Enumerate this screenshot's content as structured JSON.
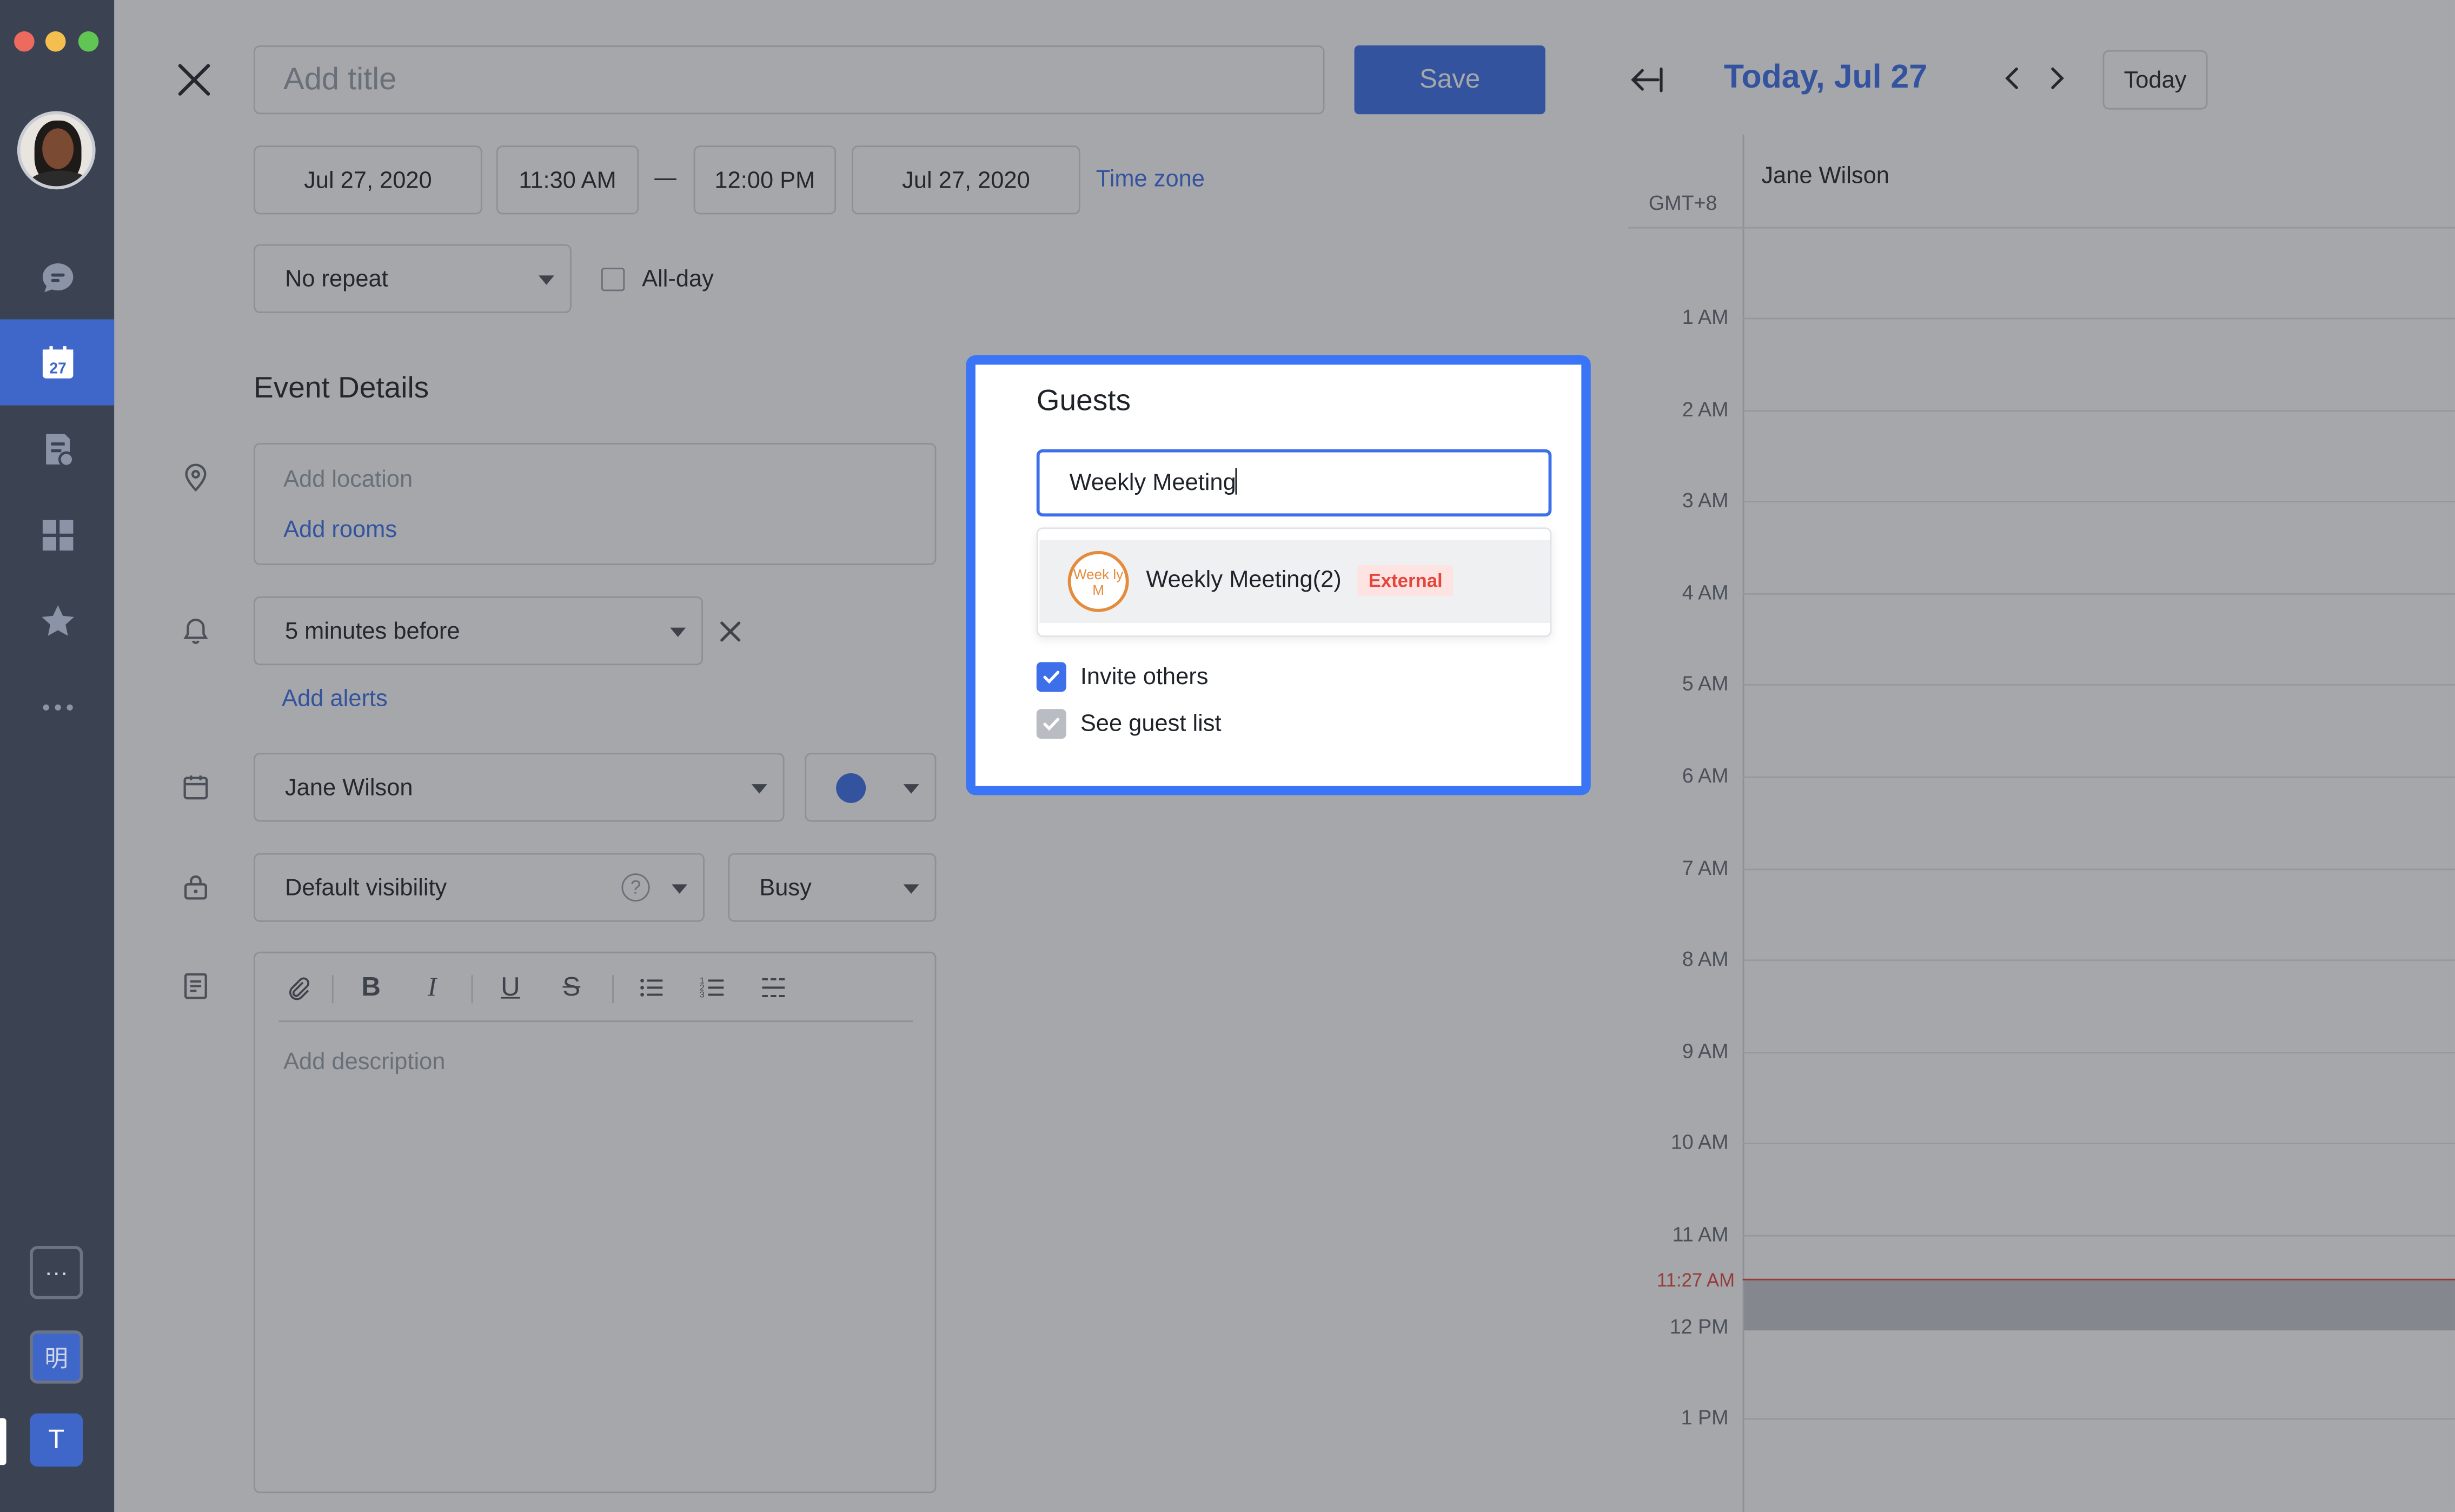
{
  "sidebar": {
    "calendar_day": "27",
    "bottom_items": [
      {
        "label": "···",
        "name": "more-apps-button"
      },
      {
        "label": "明",
        "name": "app-shortcut-button"
      },
      {
        "label": "T",
        "name": "workspace-avatar"
      }
    ],
    "active_color": "#3f66c9"
  },
  "event_form": {
    "title_placeholder": "Add title",
    "save_label": "Save",
    "start_date": "Jul 27, 2020",
    "start_time": "11:30 AM",
    "end_time": "12:00 PM",
    "end_date": "Jul 27, 2020",
    "time_zone_label": "Time zone",
    "repeat_value": "No repeat",
    "all_day_label": "All-day",
    "all_day_checked": false,
    "section_title": "Event Details",
    "location_placeholder": "Add location",
    "add_rooms_label": "Add rooms",
    "alert_value": "5 minutes before",
    "add_alerts_label": "Add alerts",
    "calendar_owner": "Jane Wilson",
    "event_color": "#3c6fe9",
    "visibility_value": "Default visibility",
    "status_value": "Busy",
    "description_placeholder": "Add description"
  },
  "calendar": {
    "date_title": "Today, Jul 27",
    "today_label": "Today",
    "owner": "Jane Wilson",
    "timezone": "GMT+8",
    "hours": [
      "1 AM",
      "2 AM",
      "3 AM",
      "4 AM",
      "5 AM",
      "6 AM",
      "7 AM",
      "8 AM",
      "9 AM",
      "10 AM",
      "11 AM",
      "12 PM",
      "1 PM"
    ],
    "now_label": "11:27 AM",
    "now_color": "#e6453b"
  },
  "guests_popup": {
    "title": "Guests",
    "input_value": "Weekly Meeting",
    "suggestion": {
      "avatar_text": "Week ly M",
      "name": "Weekly Meeting(2)",
      "badge": "External"
    },
    "invite_others_label": "Invite others",
    "invite_others_checked": true,
    "see_guest_list_label": "See guest list",
    "see_guest_list_checked": true,
    "highlight_color": "#3a74f7"
  }
}
